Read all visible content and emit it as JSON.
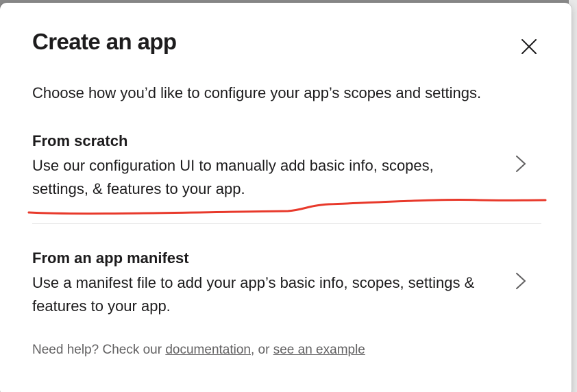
{
  "modal": {
    "title": "Create an app",
    "close_icon": "close-icon",
    "intro": "Choose how you’d like to configure your app’s scopes and settings."
  },
  "options": [
    {
      "title": "From scratch",
      "description": "Use our configuration UI to manually add basic info, scopes, settings, & features to your app.",
      "icon": "chevron-right-icon"
    },
    {
      "title": "From an app manifest",
      "description": "Use a manifest file to add your app’s basic info, scopes, settings & features to your app.",
      "icon": "chevron-right-icon"
    }
  ],
  "help": {
    "prefix": "Need help? Check our ",
    "documentation_link": "documentation",
    "separator": ", or ",
    "example_link": "see an example"
  },
  "colors": {
    "annotation_red": "#e8392b",
    "text_primary": "#1d1c1d",
    "text_secondary": "#616061"
  }
}
